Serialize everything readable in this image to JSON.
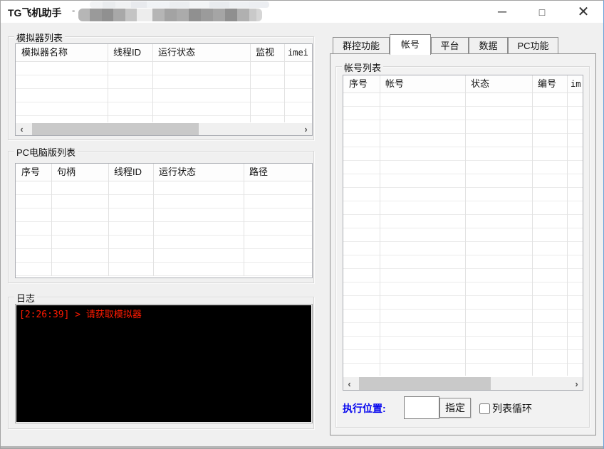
{
  "window": {
    "title": "TG飞机助手",
    "title_separator": "-",
    "controls": {
      "minimize_glyph": "─",
      "maximize_glyph": "□",
      "close_glyph": "✕"
    }
  },
  "glyphs": {
    "scroll_left": "‹",
    "scroll_right": "›"
  },
  "left_panel": {
    "emulator_group": {
      "title": "模拟器列表",
      "columns": [
        "模拟器名称",
        "线程ID",
        "运行状态",
        "监视",
        "imei"
      ]
    },
    "pc_group": {
      "title": "PC电脑版列表",
      "columns": [
        "序号",
        "句柄",
        "线程ID",
        "运行状态",
        "路径"
      ]
    },
    "log_group": {
      "title": "日志",
      "log_line": "[2:26:39] > 请获取模拟器"
    }
  },
  "right_panel": {
    "tabs": [
      {
        "label": "群控功能"
      },
      {
        "label": "帐号"
      },
      {
        "label": "平台"
      },
      {
        "label": "数据"
      },
      {
        "label": "PC功能"
      }
    ],
    "active_tab": "帐号",
    "account_group": {
      "title": "帐号列表",
      "columns": [
        "序号",
        "帐号",
        "状态",
        "编号",
        "im"
      ]
    },
    "footer": {
      "exec_label": "执行位置:",
      "input_value": "",
      "assign_button": "指定",
      "checkbox_label": "列表循环",
      "checkbox_checked": false
    }
  },
  "colors": {
    "log_text": "#ff1a00",
    "exec_label": "#0000ee",
    "window_border_accent": "#6aa1d8"
  }
}
